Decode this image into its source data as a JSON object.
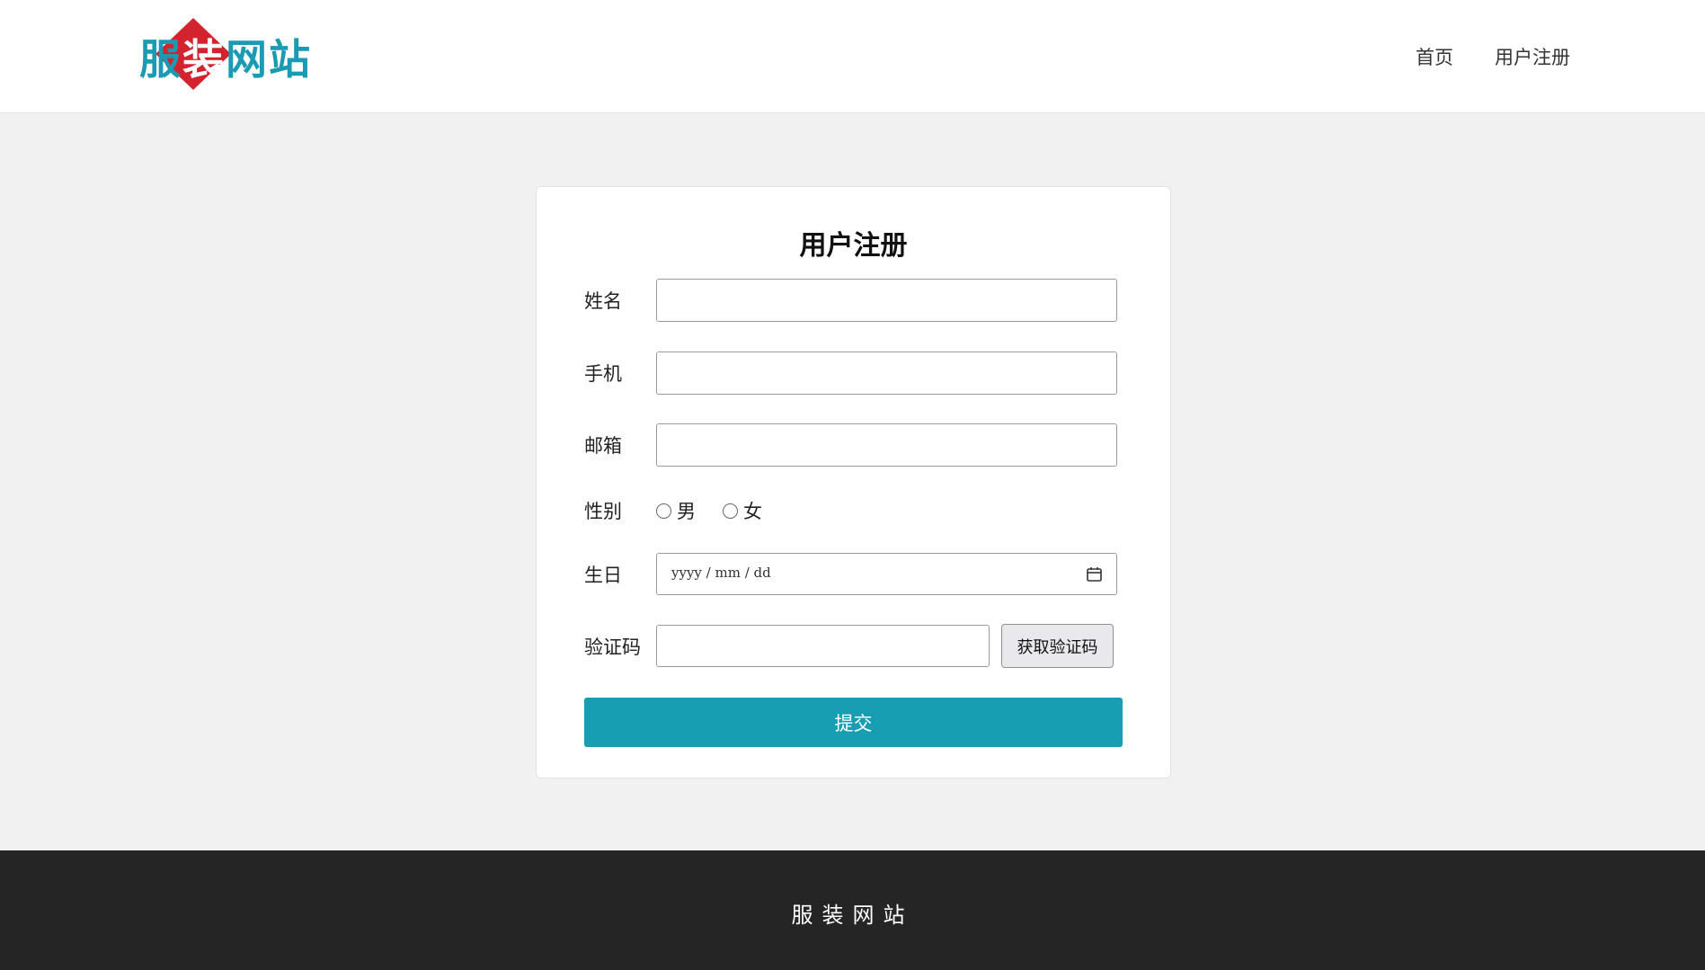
{
  "brand": {
    "name": "服装网站",
    "accent_color": "#1a9bb3",
    "diamond_color": "#d3232f"
  },
  "nav": {
    "items": [
      {
        "label": "首页"
      },
      {
        "label": "用户注册"
      }
    ]
  },
  "form": {
    "title": "用户注册",
    "fields": {
      "name": {
        "label": "姓名",
        "value": ""
      },
      "phone": {
        "label": "手机",
        "value": ""
      },
      "email": {
        "label": "邮箱",
        "value": ""
      },
      "gender": {
        "label": "性别",
        "options": [
          "男",
          "女"
        ],
        "selected": null
      },
      "birthday": {
        "label": "生日",
        "placeholder": "yyyy / mm / dd"
      },
      "code": {
        "label": "验证码",
        "value": "",
        "button_label": "获取验证码"
      }
    },
    "submit_label": "提交",
    "submit_color": "#179eb3"
  },
  "footer": {
    "text": "服装网站"
  }
}
